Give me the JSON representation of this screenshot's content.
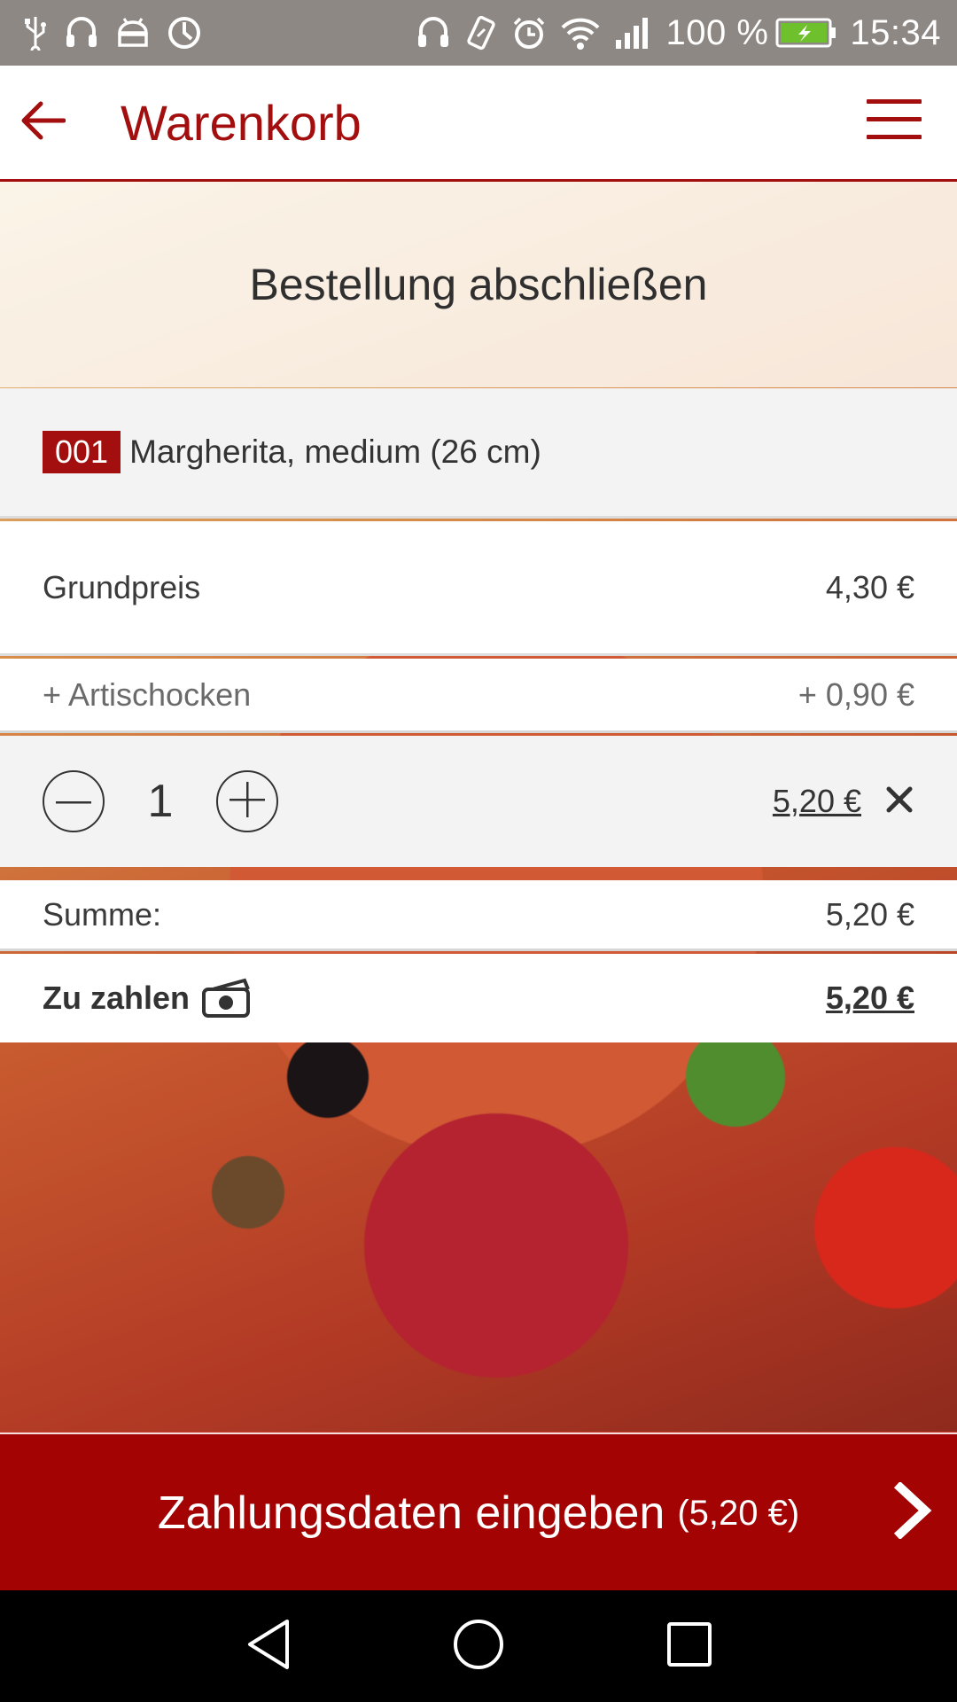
{
  "status_bar": {
    "left_icons": [
      "usb-icon",
      "headset-icon",
      "android-icon",
      "sync-icon"
    ],
    "right_icons": [
      "headphones-icon",
      "vibrate-icon",
      "alarm-icon",
      "wifi-icon",
      "signal-icon"
    ],
    "battery_percent": "100 %",
    "time": "15:34"
  },
  "app_bar": {
    "title": "Warenkorb",
    "back_icon": "arrow-left-icon",
    "menu_icon": "hamburger-menu-icon"
  },
  "page": {
    "headline": "Bestellung abschließen"
  },
  "cart_item": {
    "number": "001",
    "name": "Margherita, medium (26 cm)",
    "base_price_label": "Grundpreis",
    "base_price": "4,30 €",
    "extras": [
      {
        "label": "+ Artischocken",
        "price": "+ 0,90 €"
      }
    ],
    "quantity": "1",
    "line_total": "5,20 €"
  },
  "summary": {
    "sum_label": "Summe:",
    "sum_value": "5,20 €",
    "pay_label": "Zu zahlen",
    "pay_value": "5,20 €"
  },
  "cta": {
    "label": "Zahlungsdaten eingeben",
    "amount": "(5,20 €)"
  },
  "colors": {
    "brand_red": "#a30f0f",
    "cta_red": "#a30303",
    "status_bar": "#8e8884"
  }
}
